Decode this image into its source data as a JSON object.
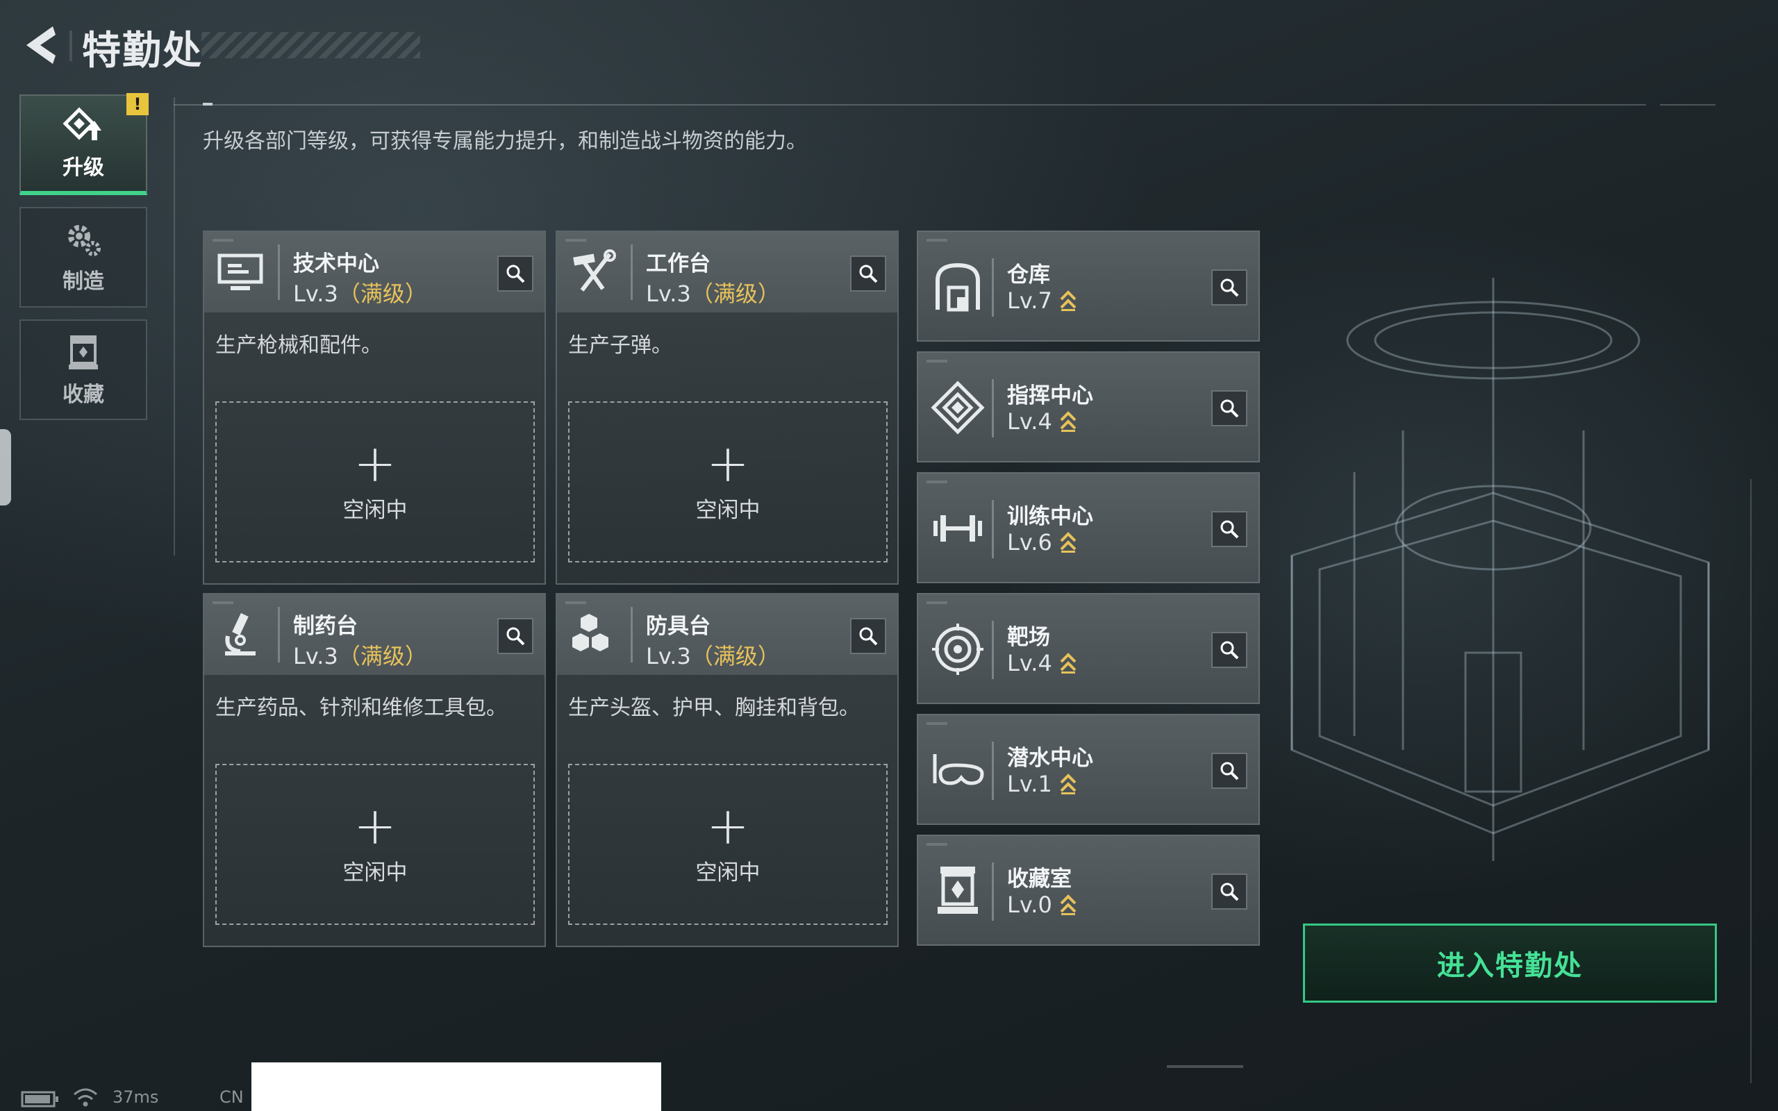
{
  "header": {
    "title": "特勤处"
  },
  "nav": [
    {
      "label": "升级",
      "icon": "upgrade-icon",
      "active": true,
      "badge": "!"
    },
    {
      "label": "制造",
      "icon": "gear-icon",
      "active": false
    },
    {
      "label": "收藏",
      "icon": "collection-icon",
      "active": false
    }
  ],
  "description": "升级各部门等级，可获得专属能力提升，和制造战斗物资的能力。",
  "production": [
    {
      "name": "技术中心",
      "level": "Lv.3",
      "max_tag": "（满级）",
      "desc": "生产枪械和配件。",
      "slot_label": "空闲中",
      "icon": "computer-icon"
    },
    {
      "name": "工作台",
      "level": "Lv.3",
      "max_tag": "（满级）",
      "desc": "生产子弹。",
      "slot_label": "空闲中",
      "icon": "tools-icon"
    },
    {
      "name": "制药台",
      "level": "Lv.3",
      "max_tag": "（满级）",
      "desc": "生产药品、针剂和维修工具包。",
      "slot_label": "空闲中",
      "icon": "microscope-icon"
    },
    {
      "name": "防具台",
      "level": "Lv.3",
      "max_tag": "（满级）",
      "desc": "生产头盔、护甲、胸挂和背包。",
      "slot_label": "空闲中",
      "icon": "cubes-icon"
    }
  ],
  "departments": [
    {
      "name": "仓库",
      "level": "Lv.7",
      "icon": "warehouse-icon"
    },
    {
      "name": "指挥中心",
      "level": "Lv.4",
      "icon": "command-icon"
    },
    {
      "name": "训练中心",
      "level": "Lv.6",
      "icon": "dumbbell-icon"
    },
    {
      "name": "靶场",
      "level": "Lv.4",
      "icon": "target-icon"
    },
    {
      "name": "潜水中心",
      "level": "Lv.1",
      "icon": "diving-mask-icon"
    },
    {
      "name": "收藏室",
      "level": "Lv.0",
      "icon": "collection-room-icon"
    }
  ],
  "enter_button": "进入特勤处",
  "status": {
    "ping": "37ms",
    "region": "CN"
  },
  "colors": {
    "accent_green": "#45e196",
    "max_level_gold": "#e7c25a",
    "warning_yellow": "#e8c43d"
  }
}
